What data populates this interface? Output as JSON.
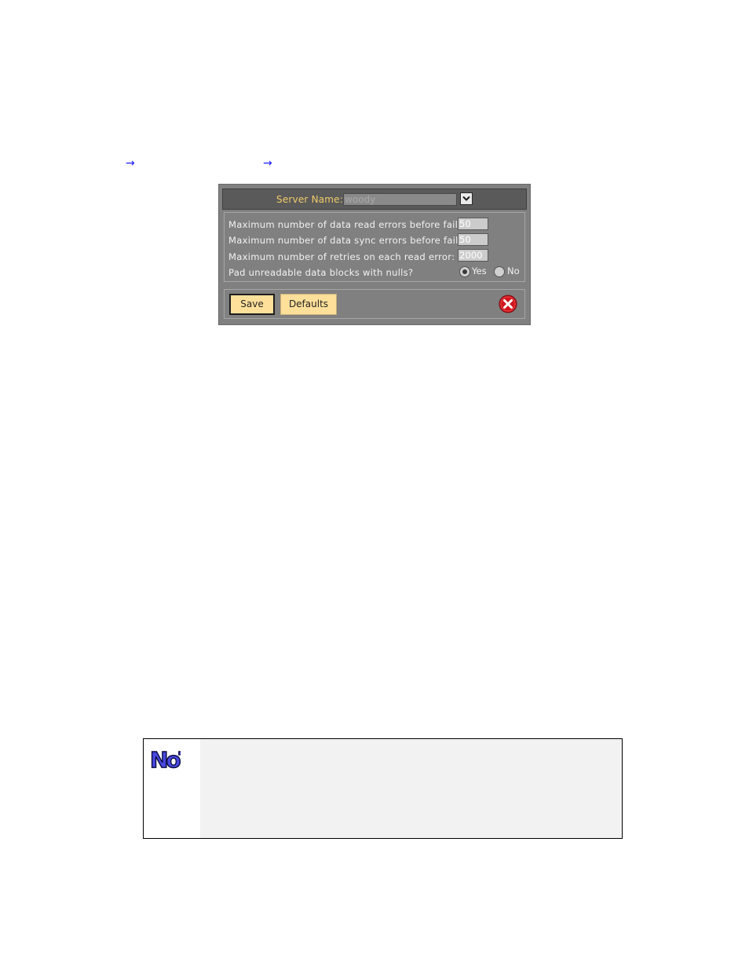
{
  "breadcrumb": {
    "arrow_glyph": "→"
  },
  "dialog": {
    "server_name_label": "Server Name:",
    "server_name_value": "woody",
    "settings": [
      {
        "label": "Maximum number of data read errors before failing:",
        "value": "50"
      },
      {
        "label": "Maximum number of data sync errors before failing:",
        "value": "50"
      },
      {
        "label": "Maximum number of retries on each read error:",
        "value": "2000"
      }
    ],
    "pad_question": "Pad unreadable data blocks with nulls?",
    "pad_options": {
      "yes_label": "Yes",
      "no_label": "No",
      "selected": "Yes"
    },
    "save_label": "Save",
    "defaults_label": "Defaults"
  },
  "note": {
    "logo_text": "NoTE"
  },
  "colors": {
    "dialog_bg": "#808080",
    "header_bg": "#5a5a5a",
    "label_accent": "#f2cc6a",
    "button_bg": "#ffe09a",
    "close_red": "#d0141c",
    "note_blue": "#4848e0"
  }
}
